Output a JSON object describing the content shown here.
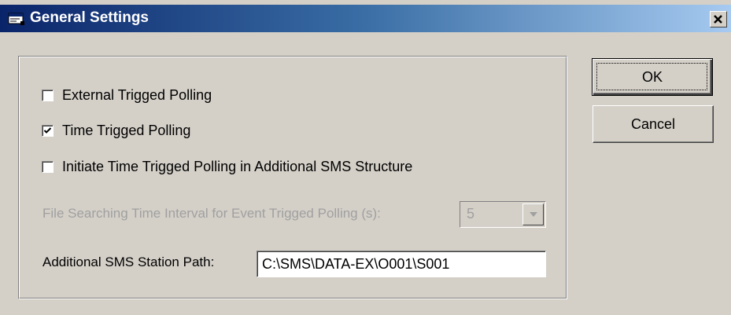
{
  "window": {
    "title": "General Settings",
    "title_icon": "app-window-icon",
    "close_icon": "close-icon"
  },
  "options": {
    "external_polling": {
      "label": "External Trigged Polling",
      "checked": false
    },
    "time_polling": {
      "label": "Time Trigged Polling",
      "checked": true
    },
    "initiate_polling": {
      "label": "Initiate Time Trigged Polling in Additional SMS Structure",
      "checked": false
    }
  },
  "interval": {
    "label": "File Searching Time Interval for Event Trigged Polling  (s):",
    "value": "5",
    "enabled": false
  },
  "station_path": {
    "label": "Additional SMS Station Path:",
    "value": "C:\\SMS\\DATA-EX\\O001\\S001"
  },
  "buttons": {
    "ok_label": "OK",
    "cancel_label": "Cancel"
  },
  "colors": {
    "title_gradient_start": "#0a246a",
    "title_gradient_end": "#a6caf0",
    "dialog_face": "#d4d0c8",
    "disabled_text": "#a0a0a0"
  }
}
